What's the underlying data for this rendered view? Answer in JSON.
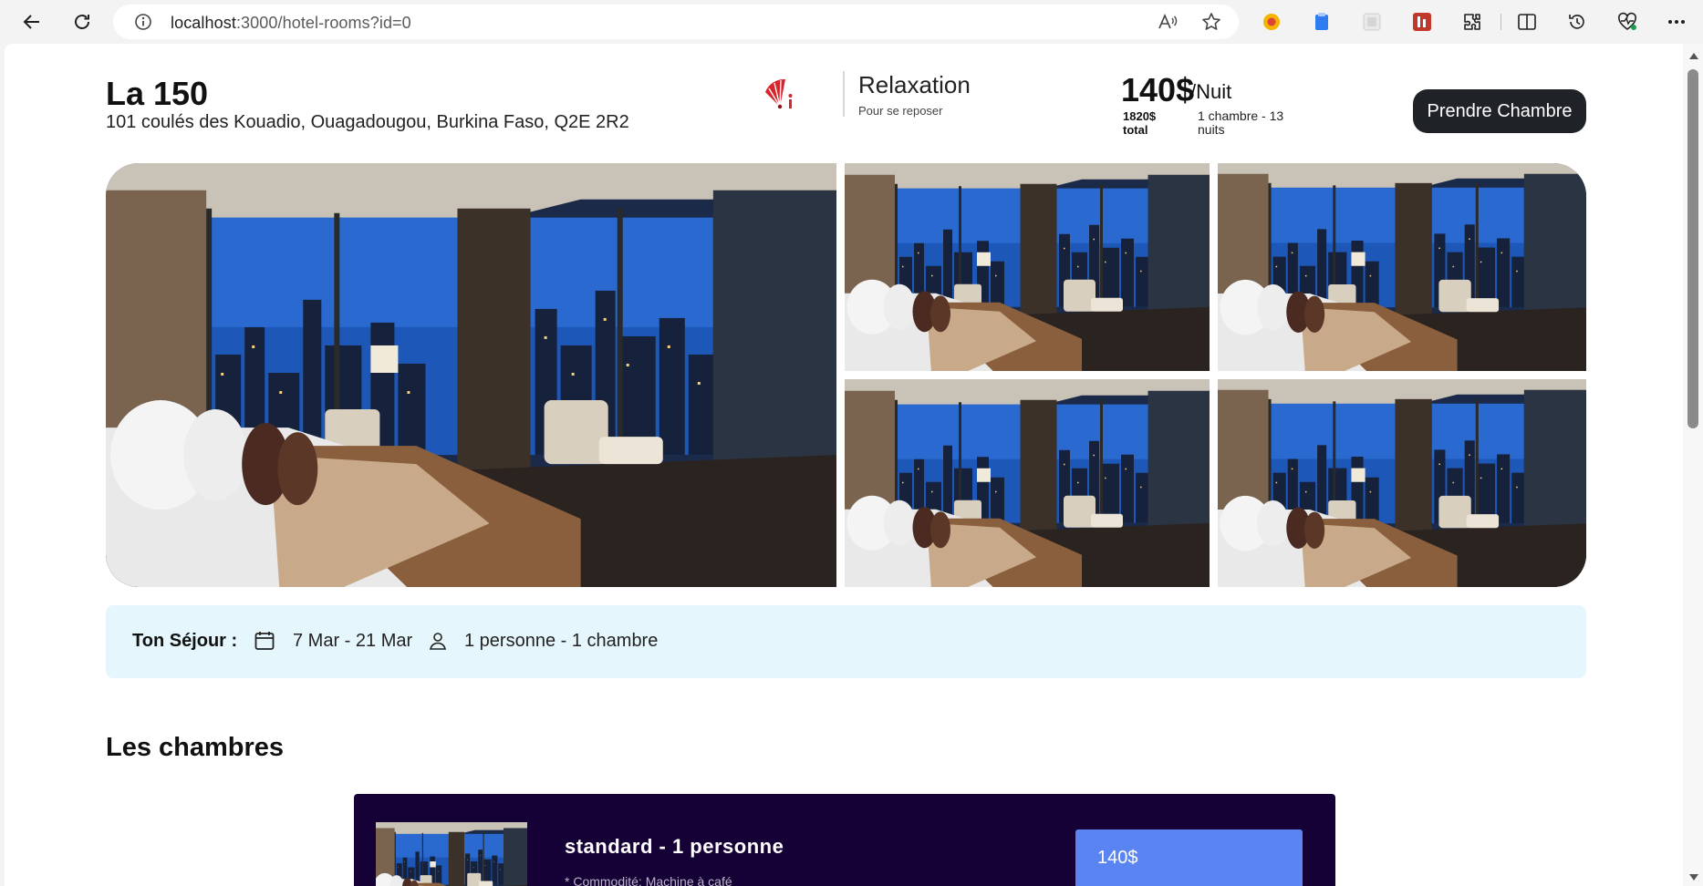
{
  "browser": {
    "url_host": "localhost",
    "url_rest": ":3000/hotel-rooms?id=0",
    "icons": [
      "back-arrow-icon",
      "refresh-icon",
      "info-icon",
      "read-aloud-icon",
      "favorite-star-icon",
      "extension-icon",
      "split-screen-icon",
      "history-icon",
      "performance-icon",
      "more-icon"
    ]
  },
  "hotel": {
    "name": "La 150",
    "address": "101 coulés des Kouadio, Ouagadougou, Burkina Faso, Q2E 2R2",
    "category_title": "Relaxation",
    "category_subtitle": "Pour se reposer",
    "price": "140$",
    "per_night": "/Nuit",
    "total_amount": "1820$",
    "total_label": "total",
    "rooms_info": "1 chambre - 13 nuits",
    "book_button": "Prendre Chambre"
  },
  "stay": {
    "label": "Ton Séjour :",
    "dates": "7 Mar - 21 Mar",
    "guests": "1 personne - 1 chambre"
  },
  "rooms_section": {
    "title": "Les chambres",
    "rooms": [
      {
        "name": "standard - 1 personne",
        "amenity": "* Commodité: Machine à café",
        "price": "140$"
      }
    ]
  },
  "colors": {
    "accent_dark": "#1f2328",
    "stay_bg": "#e5f6fd",
    "room_card_bg": "#150135",
    "room_price_bg": "#5b84f3",
    "fan_red": "#d8242b"
  }
}
